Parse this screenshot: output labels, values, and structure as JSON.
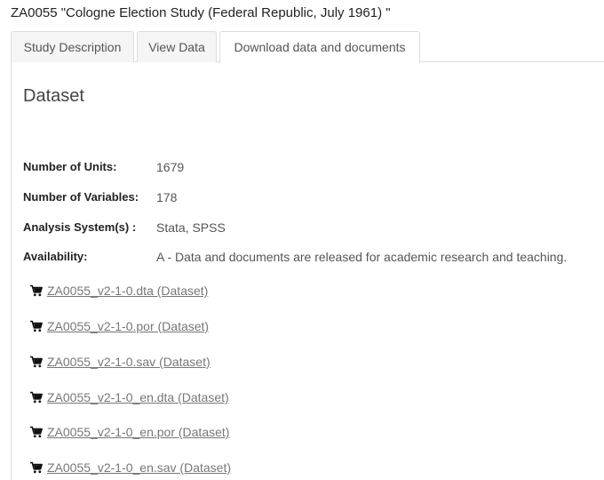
{
  "study": {
    "title": "ZA0055 \"Cologne Election Study (Federal Republic, July 1961) \""
  },
  "tabs": [
    {
      "label": "Study Description",
      "active": false
    },
    {
      "label": "View Data",
      "active": false
    },
    {
      "label": "Download data and documents",
      "active": true
    }
  ],
  "dataset": {
    "heading": "Dataset",
    "fields": [
      {
        "label": "Number of Units:",
        "value": "1679"
      },
      {
        "label": "Number of Variables:",
        "value": "178"
      },
      {
        "label": "Analysis System(s) :",
        "value": "Stata, SPSS"
      },
      {
        "label": "Availability:",
        "value": "A - Data and documents are released for academic research and teaching."
      }
    ],
    "downloads": [
      {
        "label": "ZA0055_v2-1-0.dta (Dataset)",
        "icon": "cart-icon"
      },
      {
        "label": "ZA0055_v2-1-0.por (Dataset)",
        "icon": "cart-icon"
      },
      {
        "label": "ZA0055_v2-1-0.sav (Dataset)",
        "icon": "cart-icon"
      },
      {
        "label": "ZA0055_v2-1-0_en.dta (Dataset)",
        "icon": "cart-icon"
      },
      {
        "label": "ZA0055_v2-1-0_en.por (Dataset)",
        "icon": "cart-icon"
      },
      {
        "label": "ZA0055_v2-1-0_en.sav (Dataset)",
        "icon": "cart-icon"
      }
    ]
  },
  "colors": {
    "link": "#777777",
    "border": "#dddddd",
    "tab_inactive_bg": "#f5f5f5"
  }
}
